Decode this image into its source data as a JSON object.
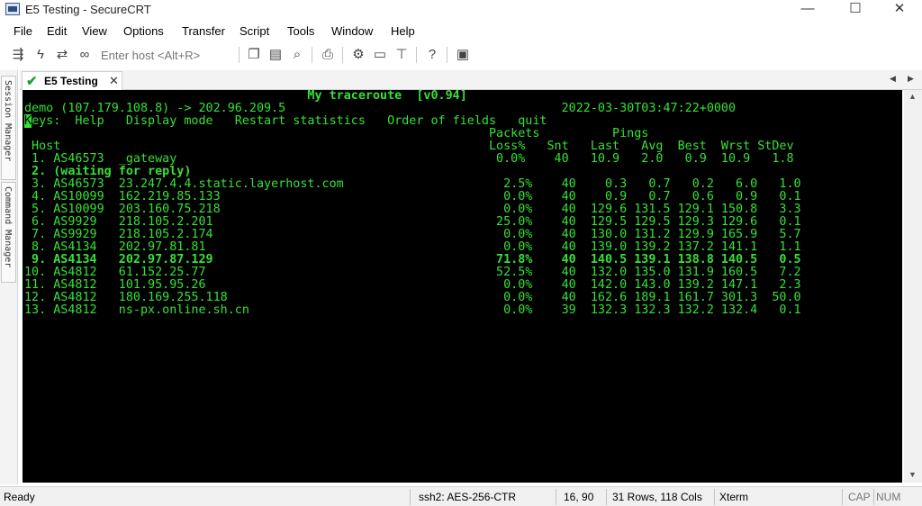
{
  "window": {
    "title": "E5 Testing - SecureCRT",
    "minimize": "—",
    "maximize": "☐",
    "close": "✕"
  },
  "menu": [
    "File",
    "Edit",
    "View",
    "Options",
    "Transfer",
    "Script",
    "Tools",
    "Window",
    "Help"
  ],
  "toolbar": {
    "quick_connect_placeholder": "Enter host <Alt+R>",
    "icons": [
      "connect-icon",
      "lightning-icon",
      "reconnect-icon",
      "link-icon",
      "copy-icon",
      "paste-icon",
      "find-icon",
      "print-icon",
      "settings-icon",
      "keymap-icon",
      "sftp-icon",
      "help-icon",
      "screen-icon"
    ]
  },
  "side_panel": {
    "session_manager": "Session Manager",
    "command_manager": "Command Manager"
  },
  "tabs": {
    "active_label": "E5 Testing",
    "close": "✕",
    "prev": "◀",
    "next": "▶"
  },
  "terminal": {
    "lines": [
      "                                       My traceroute  [v0.94]",
      "demo (107.179.108.8) -> 202.96.209.5                                      2022-03-30T03:47:22+0000",
      "eys:  Help   Display mode   Restart statistics   Order of fields   quit",
      "                                                                Packets          Pings",
      " Host                                                           Loss%   Snt   Last   Avg  Best  Wrst StDev",
      " 1. AS46573  _gateway                                            0.0%    40   10.9   2.0   0.9  10.9   1.8",
      " 2. (waiting for reply)",
      " 3. AS46573  23.247.4.4.static.layerhost.com                      2.5%    40    0.3   0.7   0.2   6.0   1.0",
      " 4. AS10099  162.219.85.133                                       0.0%    40    0.9   0.7   0.6   0.9   0.1",
      " 5. AS10099  203.160.75.218                                       0.0%    40  129.6 131.5 129.1 150.8   3.3",
      " 6. AS9929   218.105.2.201                                       25.0%    40  129.5 129.5 129.3 129.6   0.1",
      " 7. AS9929   218.105.2.174                                        0.0%    40  130.0 131.2 129.9 165.9   5.7",
      " 8. AS4134   202.97.81.81                                         0.0%    40  139.0 139.2 137.2 141.1   1.1",
      " 9. AS4134   202.97.87.129                                       71.8%    40  140.5 139.1 138.8 140.5   0.5",
      "10. AS4812   61.152.25.77                                        52.5%    40  132.0 135.0 131.9 160.5   7.2",
      "11. AS4812   101.95.95.26                                         0.0%    40  142.0 143.0 139.2 147.1   2.3",
      "12. AS4812   180.169.255.118                                      0.0%    40  162.6 189.1 161.7 301.3  50.0",
      "13. AS4812   ns-px.online.sh.cn                                   0.0%    39  132.3 132.3 132.2 132.4   0.1"
    ],
    "cursor_char": "K",
    "text_color": "#36e136",
    "background": "#000000"
  },
  "status": {
    "ready": "Ready",
    "cipher": "ssh2: AES-256-CTR",
    "cursor_pos": "16, 90",
    "dimensions": "31 Rows, 118 Cols",
    "terminal_type": "Xterm",
    "cap": "CAP",
    "num": "NUM"
  }
}
